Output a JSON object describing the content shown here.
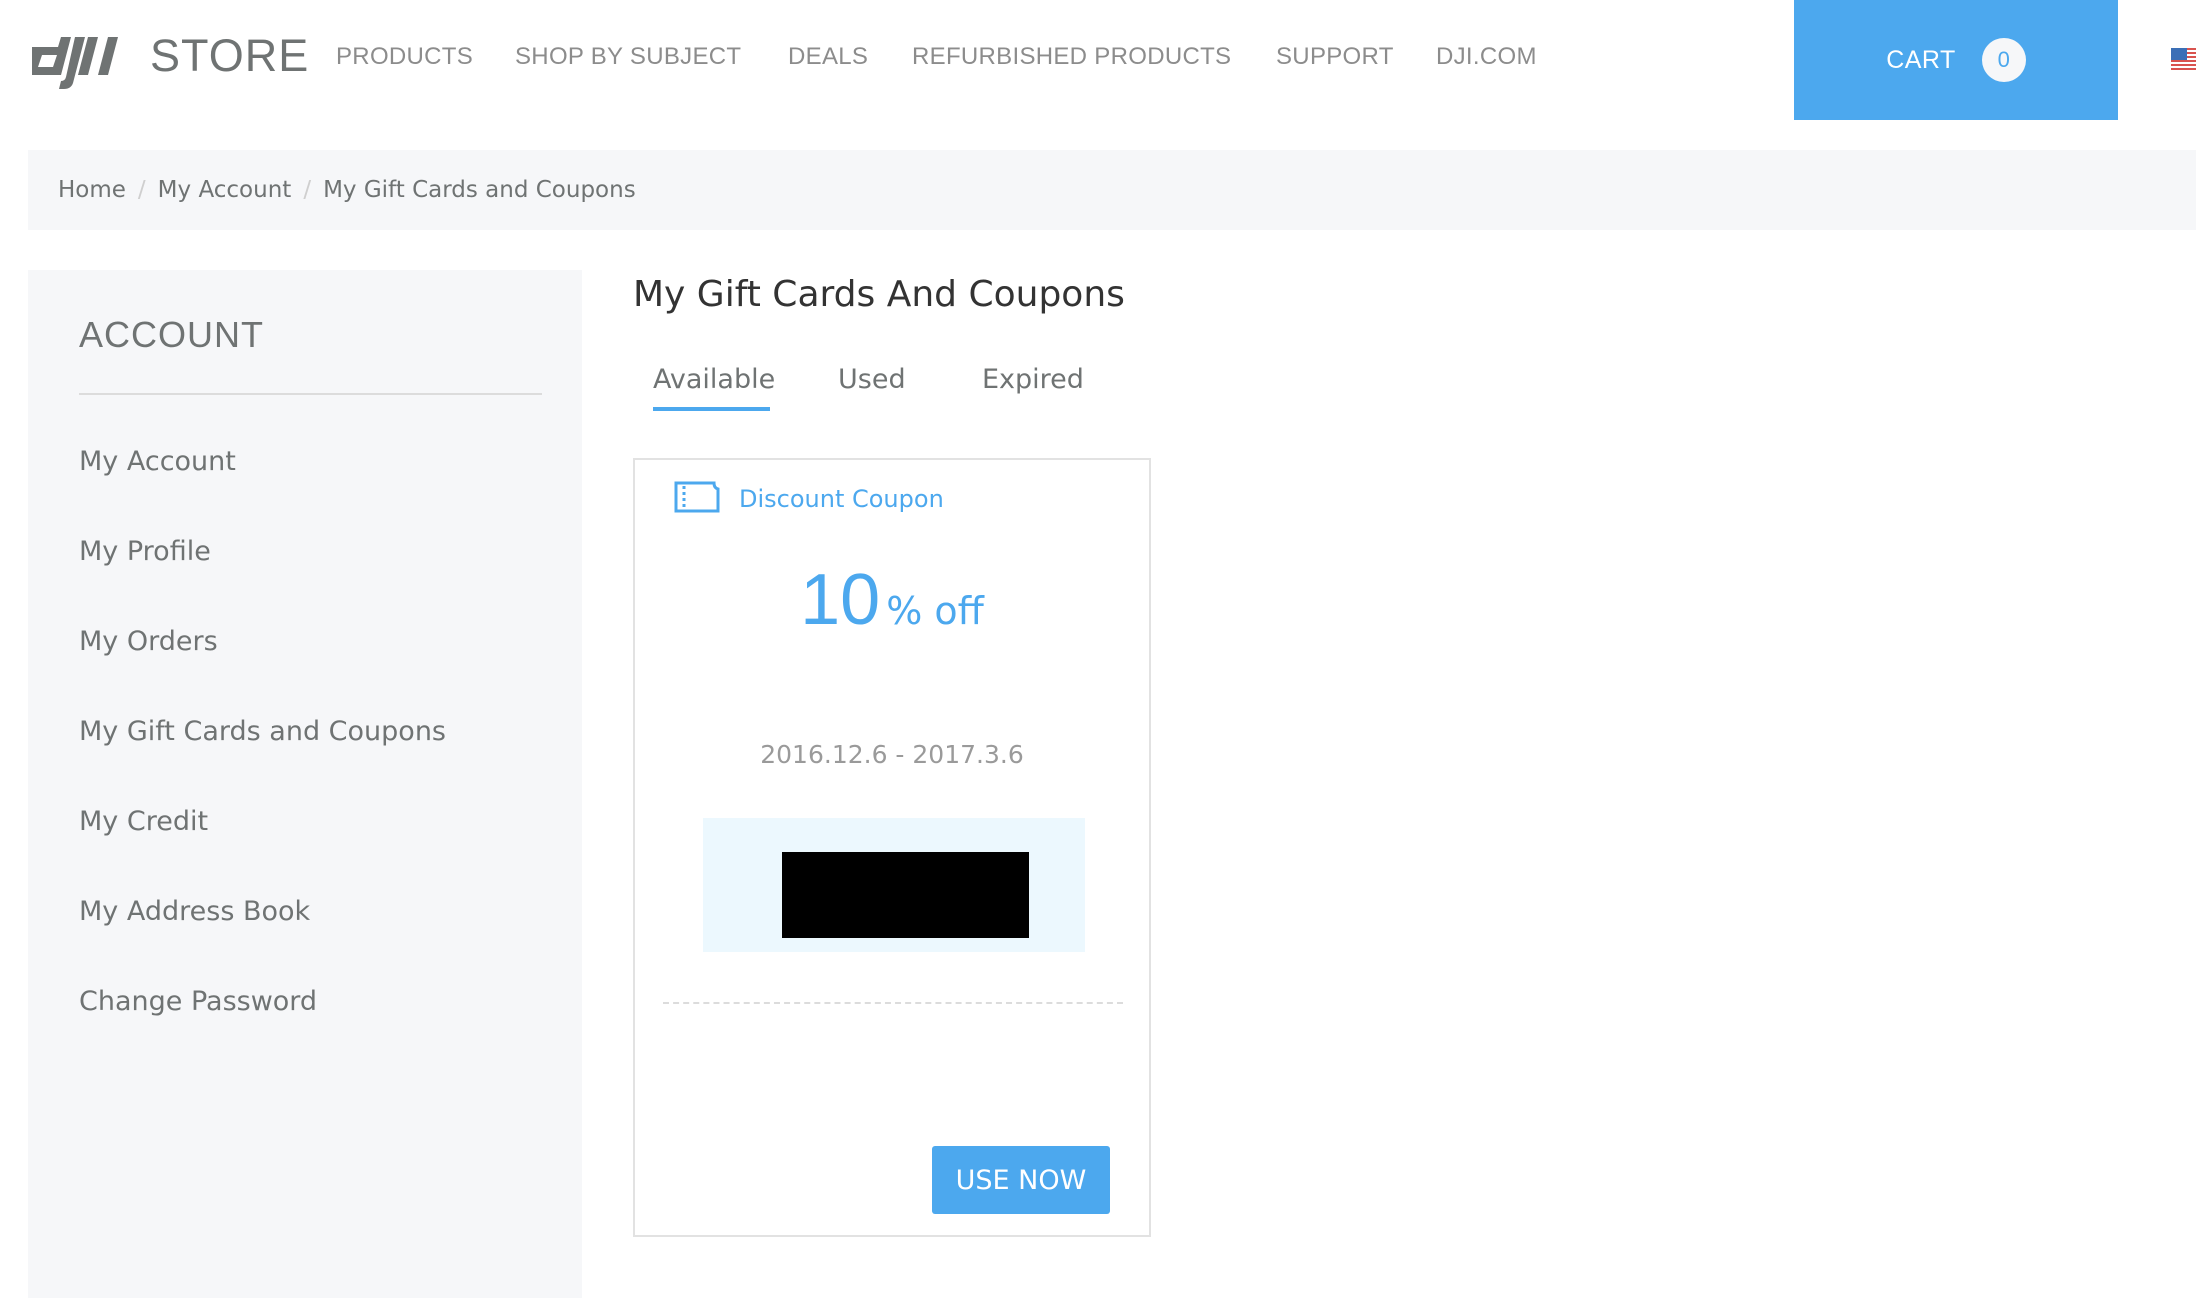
{
  "header": {
    "brand_logo": "dji",
    "brand_store": "STORE",
    "nav": [
      {
        "label": "PRODUCTS"
      },
      {
        "label": "SHOP BY SUBJECT"
      },
      {
        "label": "DEALS"
      },
      {
        "label": "REFURBISHED PRODUCTS"
      },
      {
        "label": "SUPPORT"
      },
      {
        "label": "DJI.COM"
      }
    ],
    "cart": {
      "label": "CART",
      "count": "0"
    },
    "region_flag": "us-flag-icon"
  },
  "breadcrumb": {
    "items": [
      {
        "label": "Home"
      },
      {
        "label": "My Account"
      },
      {
        "label": "My Gift Cards and Coupons"
      }
    ],
    "separator": "/"
  },
  "sidebar": {
    "title": "ACCOUNT",
    "items": [
      {
        "label": "My Account"
      },
      {
        "label": "My Profile"
      },
      {
        "label": "My Orders"
      },
      {
        "label": "My Gift Cards and Coupons"
      },
      {
        "label": "My Credit"
      },
      {
        "label": "My Address Book"
      },
      {
        "label": "Change Password"
      }
    ]
  },
  "main": {
    "title": "My Gift Cards And Coupons",
    "tabs": [
      {
        "label": "Available",
        "active": true
      },
      {
        "label": "Used",
        "active": false
      },
      {
        "label": "Expired",
        "active": false
      }
    ],
    "coupon": {
      "icon": "ticket-icon",
      "type": "Discount Coupon",
      "value": "10",
      "unit": "% off",
      "validity": "2016.12.6 - 2017.3.6",
      "code": "[redacted]",
      "action_label": "USE NOW"
    }
  },
  "colors": {
    "accent": "#4ca8ee",
    "panel_bg": "#f6f7f9",
    "text_gray": "#6f7373",
    "code_bg": "#ecf8fe"
  }
}
